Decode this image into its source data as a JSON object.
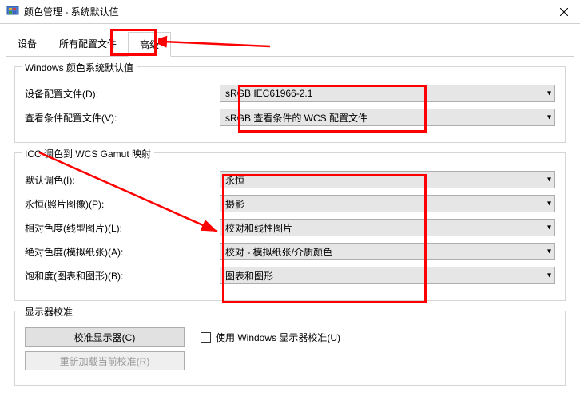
{
  "window": {
    "title": "颜色管理 - 系统默认值"
  },
  "tabs": {
    "device": "设备",
    "profiles": "所有配置文件",
    "advanced": "高级"
  },
  "group1": {
    "title": "Windows 颜色系统默认值",
    "device_profile_label": "设备配置文件(D):",
    "device_profile_value": "sRGB IEC61966-2.1",
    "view_cond_label": "查看条件配置文件(V):",
    "view_cond_value": "sRGB 查看条件的 WCS 配置文件"
  },
  "group2": {
    "title": "ICC 调色到 WCS Gamut 映射",
    "default_label": "默认调色(I):",
    "default_value": "永恒",
    "perm_label": "永恒(照片图像)(P):",
    "perm_value": "摄影",
    "rel_label": "相对色度(线型图片)(L):",
    "rel_value": "校对和线性图片",
    "abs_label": "绝对色度(模拟纸张)(A):",
    "abs_value": "校对 - 模拟纸张/介质颜色",
    "sat_label": "饱和度(图表和图形)(B):",
    "sat_value": "图表和图形"
  },
  "group3": {
    "title": "显示器校准",
    "calibrate_btn": "校准显示器(C)",
    "reload_btn": "重新加载当前校准(R)",
    "use_windows_label": "使用 Windows 显示器校准(U)"
  }
}
